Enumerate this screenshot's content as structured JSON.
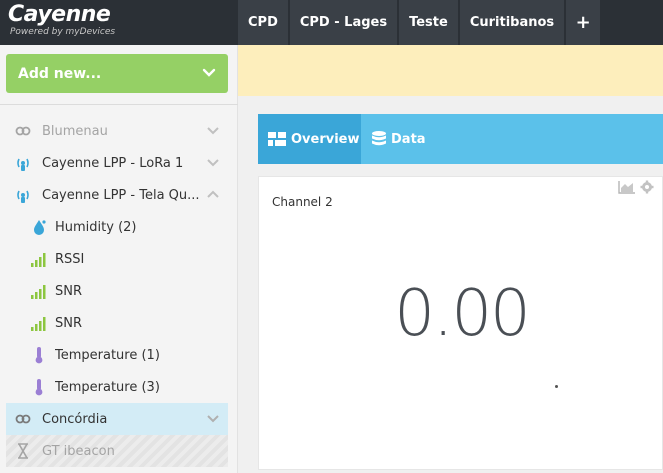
{
  "app": {
    "logo_title": "Cayenne",
    "logo_subtitle": "Powered by myDevices"
  },
  "top_tabs": [
    "CPD",
    "CPD - Lages",
    "Teste",
    "Curitibanos",
    "+"
  ],
  "sidebar": {
    "add_new_label": "Add new...",
    "items": [
      {
        "label": "Blumenau",
        "icon": "link-icon",
        "state": "muted",
        "chevron": "down"
      },
      {
        "label": "Cayenne LPP - LoRa 1",
        "icon": "wireless-device-icon",
        "state": "normal",
        "chevron": "down"
      },
      {
        "label": "Cayenne LPP - Tela Qu...",
        "icon": "wireless-device-icon",
        "state": "normal",
        "chevron": "up"
      },
      {
        "label": "Humidity (2)",
        "icon": "humidity-drop-icon",
        "state": "child"
      },
      {
        "label": "RSSI",
        "icon": "signal-bars-icon",
        "state": "child"
      },
      {
        "label": "SNR",
        "icon": "signal-bars-icon",
        "state": "child"
      },
      {
        "label": "SNR",
        "icon": "signal-bars-icon",
        "state": "child"
      },
      {
        "label": "Temperature (1)",
        "icon": "thermometer-icon",
        "state": "child"
      },
      {
        "label": "Temperature (3)",
        "icon": "thermometer-icon",
        "state": "child"
      },
      {
        "label": "Concórdia",
        "icon": "link-icon",
        "state": "selected",
        "chevron": "down"
      },
      {
        "label": "GT ibeacon",
        "icon": "hourglass-icon",
        "state": "pending"
      }
    ]
  },
  "content_tabs": {
    "overview_label": "Overview",
    "data_label": "Data"
  },
  "widget": {
    "title": "Channel 2",
    "value": "0.00"
  },
  "colors": {
    "topbar": "#2b3036",
    "add_new": "#95d065",
    "banner": "#fdeebc",
    "tabs_bg": "#5bc1ea",
    "tab_active": "#3aa6d8",
    "selected_row": "#d3ecf6",
    "signal_green": "#8cc63f",
    "humidity_blue": "#3aa6d8",
    "thermo_purple": "#9b7fd4"
  }
}
